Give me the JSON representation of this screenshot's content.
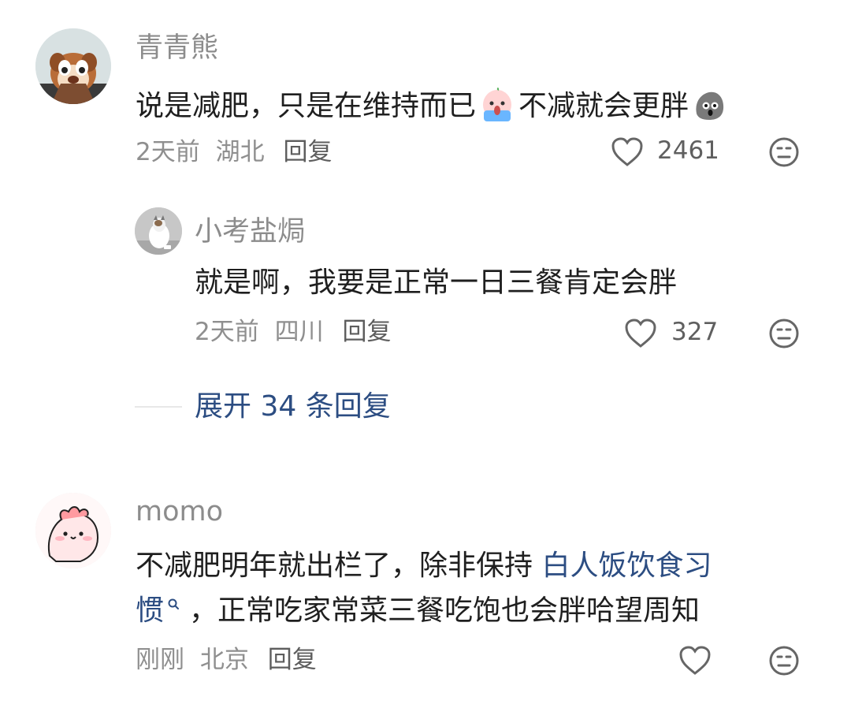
{
  "comments": [
    {
      "username": "青青熊",
      "text_before": "说是减肥，只是在维持而已",
      "emoji_1": "scared-face-emoji",
      "text_after": "不减就会更胖",
      "emoji_2": "shocked-rock-emoji",
      "time": "2天前",
      "location": "湖北",
      "reply": "回复",
      "likes": "2461"
    },
    {
      "username": "小考盐焗",
      "text": "就是啊，我要是正常一日三餐肯定会胖",
      "time": "2天前",
      "location": "四川",
      "reply": "回复",
      "likes": "327"
    },
    {
      "username": "momo",
      "text_line1_plain": "不减肥明年就出栏了，除非保持 ",
      "text_line1_link": "白人饭饮食习",
      "text_line2_link": "惯",
      "text_line2_plain": "，正常吃家常菜三餐吃饱也会胖哈望周知",
      "time": "刚刚",
      "location": "北京",
      "reply": "回复",
      "likes": ""
    }
  ],
  "expand_replies": "展开 34 条回复",
  "colors": {
    "username": "#8c8c8c",
    "meta": "#8f8f8f",
    "link": "#2c4d82",
    "icon": "#666666"
  }
}
